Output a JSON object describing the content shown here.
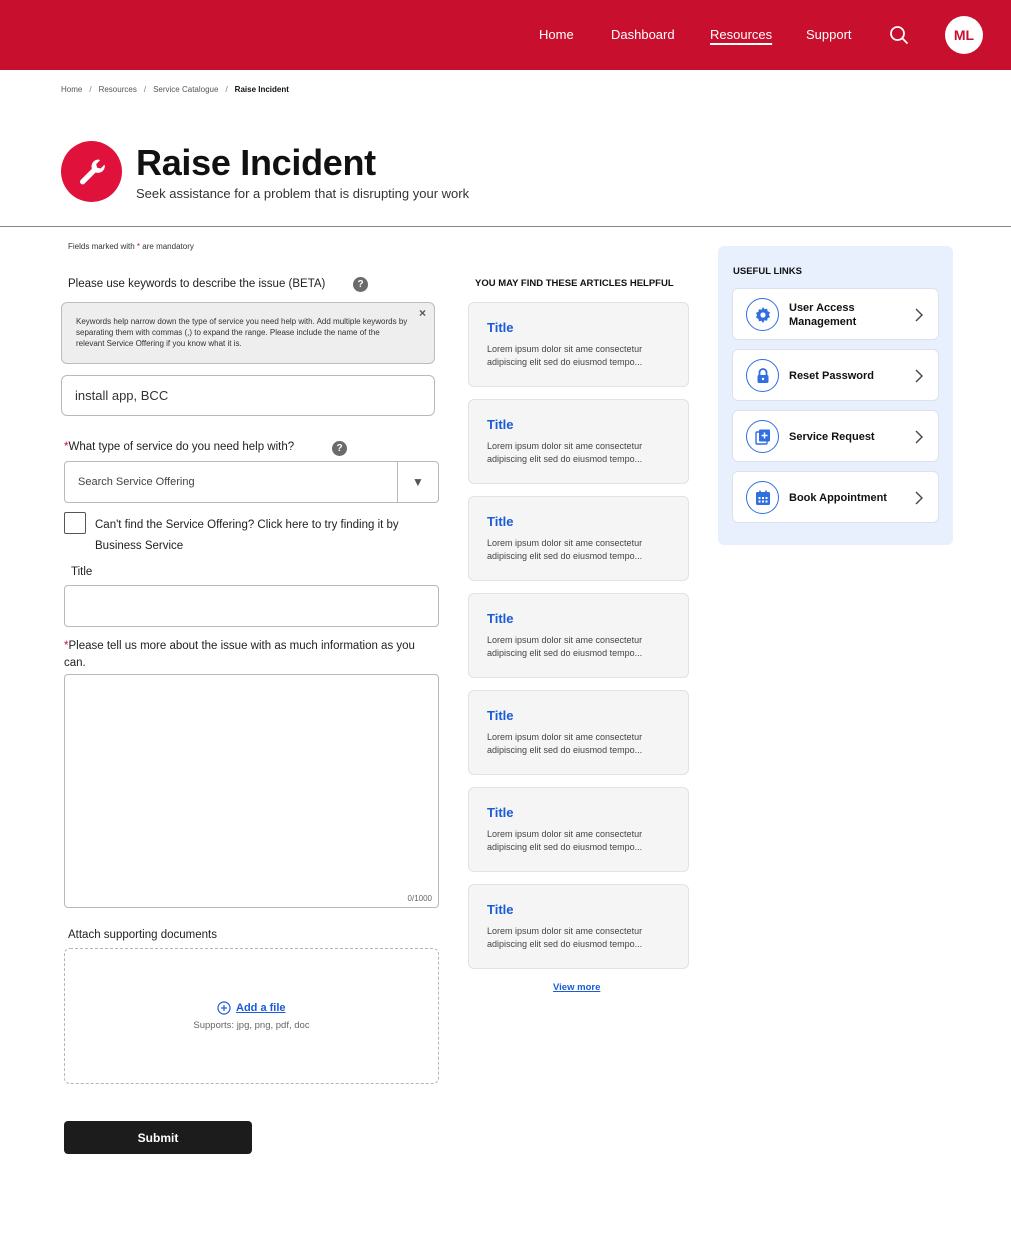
{
  "header": {
    "nav": [
      "Home",
      "Dashboard",
      "Resources",
      "Support"
    ],
    "active_nav": "Resources",
    "avatar_initials": "ML",
    "brand_color": "#c8102e"
  },
  "breadcrumb": [
    "Home",
    "Resources",
    "Service Catalogue",
    "Raise Incident"
  ],
  "page": {
    "icon": "wrench-icon",
    "title": "Raise Incident",
    "subtitle": "Seek assistance for a problem that is disrupting your work"
  },
  "form": {
    "mandatory_note_prefix": "Fields marked with",
    "mandatory_star": "*",
    "mandatory_note_suffix": "are mandatory",
    "keywords_label": "Please use keywords to describe the issue (BETA)",
    "keywords_info": "Keywords help narrow down the type of service you need help with. Add multiple keywords by separating them with commas (,) to expand the range. Please include the name of the relevant Service Offering if you know what it is.",
    "keywords_value": "install app, BCC",
    "service_label": "What type of service do you need help with?",
    "service_placeholder": "Search Service Offering",
    "checkbox_label": "Can't find the Service Offering? Click here to try finding it by Business Service",
    "title_label": "Title",
    "description_label": "Please tell us more about the issue with as much information as you can.",
    "char_count": "0/1000",
    "attach_label": "Attach supporting documents",
    "add_file_label": "Add a file",
    "supports_text": "Supports: jpg, png, pdf, doc",
    "submit_label": "Submit"
  },
  "articles": {
    "heading": "YOU MAY FIND THESE ARTICLES HELPFUL",
    "items": [
      {
        "title": "Title",
        "line1": "Lorem ipsum dolor sit ame consectetur",
        "line2": "adipiscing elit sed do eiusmod tempo..."
      },
      {
        "title": "Title",
        "line1": "Lorem ipsum dolor sit ame consectetur",
        "line2": "adipiscing elit sed do eiusmod tempo..."
      },
      {
        "title": "Title",
        "line1": "Lorem ipsum dolor sit ame consectetur",
        "line2": "adipiscing elit sed do eiusmod tempo..."
      },
      {
        "title": "Title",
        "line1": "Lorem ipsum dolor sit ame consectetur",
        "line2": "adipiscing elit sed do eiusmod tempo..."
      },
      {
        "title": "Title",
        "line1": "Lorem ipsum dolor sit ame consectetur",
        "line2": "adipiscing elit sed do eiusmod tempo..."
      },
      {
        "title": "Title",
        "line1": "Lorem ipsum dolor sit ame consectetur",
        "line2": "adipiscing elit sed do eiusmod tempo..."
      },
      {
        "title": "Title",
        "line1": "Lorem ipsum dolor sit ame consectetur",
        "line2": "adipiscing elit sed do eiusmod tempo..."
      }
    ],
    "view_more": "View more"
  },
  "useful_links": {
    "heading": "USEFUL LINKS",
    "items": [
      {
        "label": "User Access Management",
        "icon": "gear-icon"
      },
      {
        "label": "Reset Password",
        "icon": "lock-icon"
      },
      {
        "label": "Service Request",
        "icon": "add-document-icon"
      },
      {
        "label": "Book Appointment",
        "icon": "calendar-icon"
      }
    ]
  }
}
